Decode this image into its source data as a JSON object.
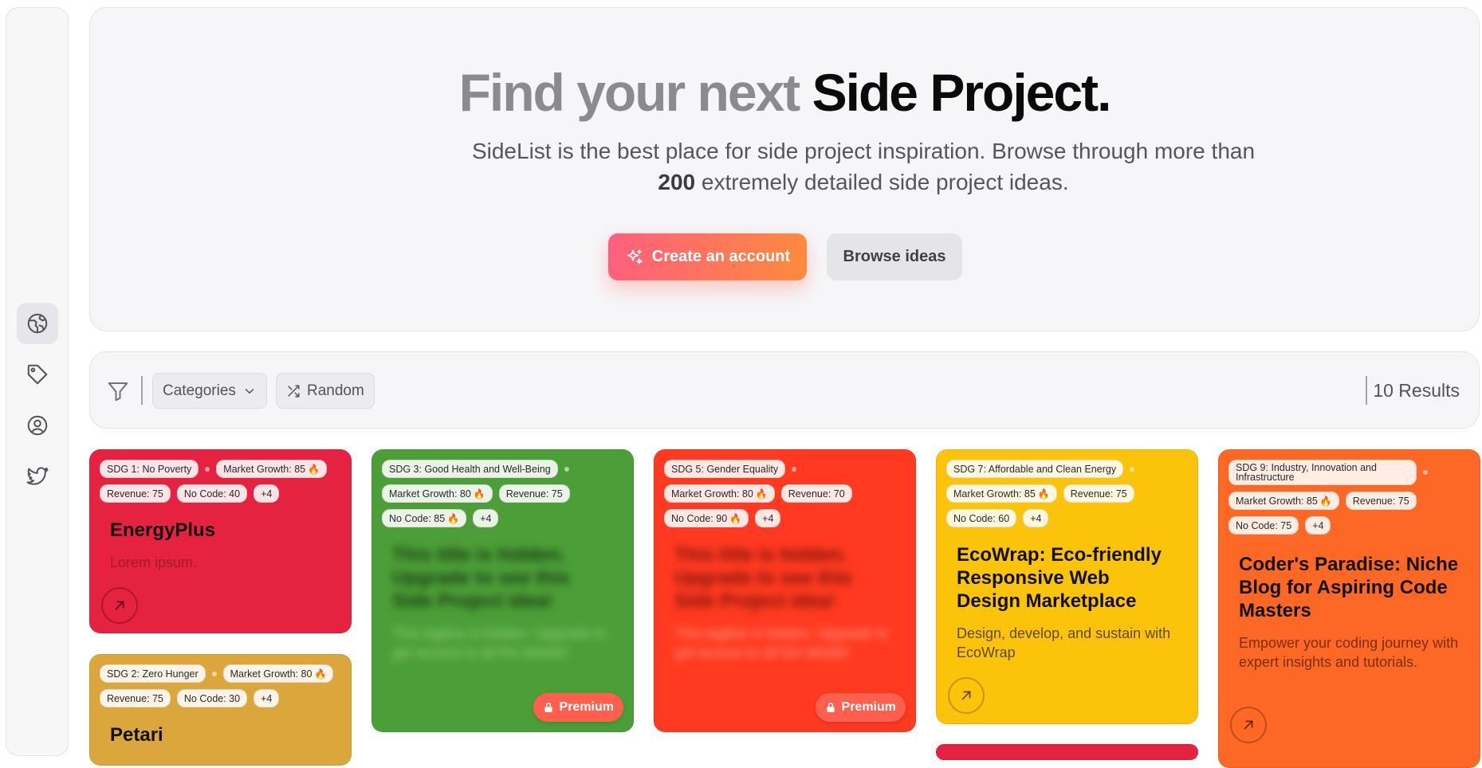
{
  "hero": {
    "title_muted": "Find your next",
    "title_strong": "Side Project.",
    "subtitle_pre": "SideList is the best place for side project inspiration. Browse through more than ",
    "subtitle_num": "200",
    "subtitle_post": " extremely detailed side project ideas.",
    "create_label": "Create an account",
    "browse_label": "Browse ideas"
  },
  "filters": {
    "categories_label": "Categories",
    "random_label": "Random",
    "results_label": "10 Results"
  },
  "cards": [
    {
      "color": "#e5223f",
      "sdg": "SDG 1: No Poverty",
      "tags": [
        "Market Growth: 85",
        "Revenue: 75",
        "No Code: 40",
        "+4"
      ],
      "title": "EnergyPlus",
      "desc": "Lorem ipsum."
    },
    {
      "color": "#dba63b",
      "sdg": "SDG 2: Zero Hunger",
      "tags": [
        "Market Growth: 80",
        "Revenue: 75",
        "No Code: 30",
        "+4"
      ],
      "title": "Petari"
    },
    {
      "color": "#4c9f38",
      "sdg": "SDG 3: Good Health and Well-Being",
      "tags": [
        "Market Growth: 80",
        "Revenue: 75",
        "No Code: 85",
        "+4"
      ],
      "title": "This title is hidden. Upgrade to see this Side Project idea!",
      "desc": "This tagline is hidden. Upgrade to get access to all the details!",
      "premium": "Premium"
    },
    {
      "color": "#ff3a21",
      "sdg": "SDG 5: Gender Equality",
      "tags": [
        "Market Growth: 80",
        "Revenue: 70",
        "No Code: 90",
        "+4"
      ],
      "title": "This title is hidden. Upgrade to see this Side Project idea!",
      "desc": "This tagline is hidden. Upgrade to get access to all the details!",
      "premium": "Premium"
    },
    {
      "color": "#fcc30b",
      "sdg": "SDG 7: Affordable and Clean Energy",
      "tags": [
        "Market Growth: 85",
        "Revenue: 75",
        "No Code: 60",
        "+4"
      ],
      "title": "EcoWrap: Eco-friendly Responsive Web Design Marketplace",
      "desc": "Design, develop, and sustain with EcoWrap"
    },
    {
      "color": "#fd6925",
      "sdg": "SDG 9: Industry, Innovation and Infrastructure",
      "tags": [
        "Market Growth: 85",
        "Revenue: 75",
        "No Code: 75",
        "+4"
      ],
      "title": "Coder's Paradise: Niche Blog for Aspiring Code Masters",
      "desc": "Empower your coding journey with expert insights and tutorials."
    }
  ]
}
